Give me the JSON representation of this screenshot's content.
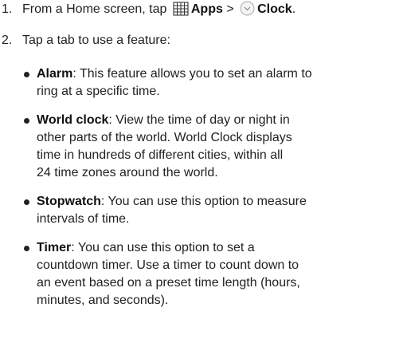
{
  "step1": {
    "number": "1.",
    "text_before": "From a Home screen, tap",
    "apps_label": "Apps",
    "separator": ">",
    "clock_label": "Clock",
    "end_period": ".",
    "apps_icon": "apps-grid-icon",
    "clock_icon": "clock-icon"
  },
  "step2": {
    "number": "2.",
    "text": "Tap a tab to use a feature:"
  },
  "features": [
    {
      "name": "Alarm",
      "lines": [
        ": This feature allows you to set an alarm to",
        "ring at a specific time."
      ]
    },
    {
      "name": "World clock",
      "lines": [
        ": View the time of day or night in",
        "other parts of the world. World Clock displays",
        "time in hundreds of different cities, within all",
        "24 time zones around the world."
      ]
    },
    {
      "name": "Stopwatch",
      "lines": [
        ": You can use this option to measure",
        "intervals of time."
      ]
    },
    {
      "name": "Timer",
      "lines": [
        ": You can use this option to set a",
        "countdown timer. Use a timer to count down to",
        "an event based on a preset time length (hours,",
        "minutes, and seconds)."
      ]
    }
  ]
}
